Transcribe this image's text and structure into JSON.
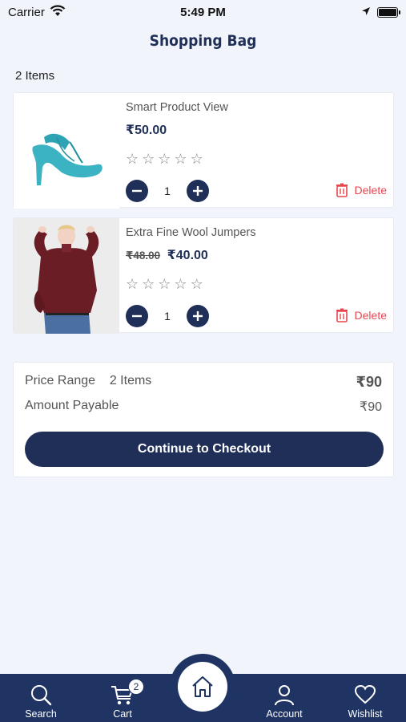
{
  "status": {
    "carrier": "Carrier",
    "time": "5:49 PM"
  },
  "header": {
    "title": "Shopping Bag"
  },
  "bag": {
    "items_count": "2 Items"
  },
  "products": [
    {
      "name": "Smart Product View",
      "price": "₹50.00",
      "old_price": "",
      "rating": 0,
      "quantity": "1",
      "delete_label": "Delete",
      "image": "turquoise-heel-shoe"
    },
    {
      "name": "Extra Fine Wool Jumpers",
      "price": "₹40.00",
      "old_price": "₹48.00",
      "rating": 0,
      "quantity": "1",
      "delete_label": "Delete",
      "image": "woman-in-maroon-sweater"
    }
  ],
  "summary": {
    "price_range_label": "Price Range",
    "price_range_items": "2 Items",
    "price_range_value": "₹90",
    "amount_payable_label": "Amount Payable",
    "amount_payable_value": "₹90",
    "checkout_label": "Continue to Checkout"
  },
  "tabbar": {
    "search": "Search",
    "cart": "Cart",
    "cart_badge": "2",
    "account": "Account",
    "wishlist": "Wishlist"
  },
  "colors": {
    "primary": "#1f2f57",
    "tabbar": "#1f3462",
    "delete": "#e8464e",
    "background": "#f1f5fb"
  },
  "icons": [
    "wifi-icon",
    "location-arrow-icon",
    "battery-icon",
    "minus-icon",
    "plus-icon",
    "trash-icon",
    "star-icon",
    "search-icon",
    "cart-icon",
    "home-icon",
    "account-icon",
    "heart-icon"
  ]
}
